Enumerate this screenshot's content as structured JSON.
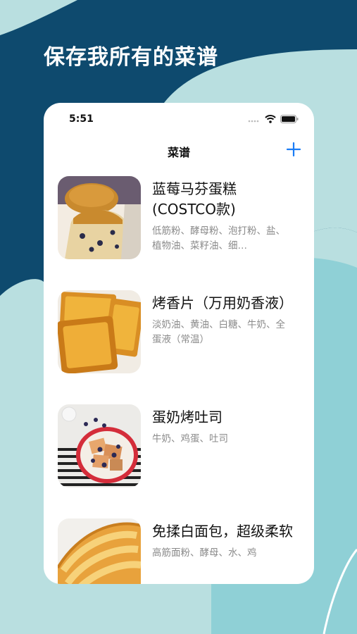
{
  "headline": "保存我所有的菜谱",
  "status_bar": {
    "time": "5:51"
  },
  "nav": {
    "title": "菜谱",
    "add_icon": "plus-icon",
    "accent": "#1a7cf5"
  },
  "colors": {
    "dark_blue": "#0e4a6e",
    "teal": "#8fd0d6",
    "light": "#b9dfe0"
  },
  "recipes": [
    {
      "name": "蓝莓马芬蛋糕(COSTCO款)",
      "ingredients": "低筋粉、酵母粉、泡打粉、盐、植物油、菜籽油、细…"
    },
    {
      "name": "烤香片（万用奶香液）",
      "ingredients": "淡奶油、黄油、白糖、牛奶、全蛋液（常温）"
    },
    {
      "name": "蛋奶烤吐司",
      "ingredients": "牛奶、鸡蛋、吐司"
    },
    {
      "name": "免揉白面包，超级柔软",
      "ingredients": "高筋面粉、酵母、水、鸡"
    }
  ]
}
